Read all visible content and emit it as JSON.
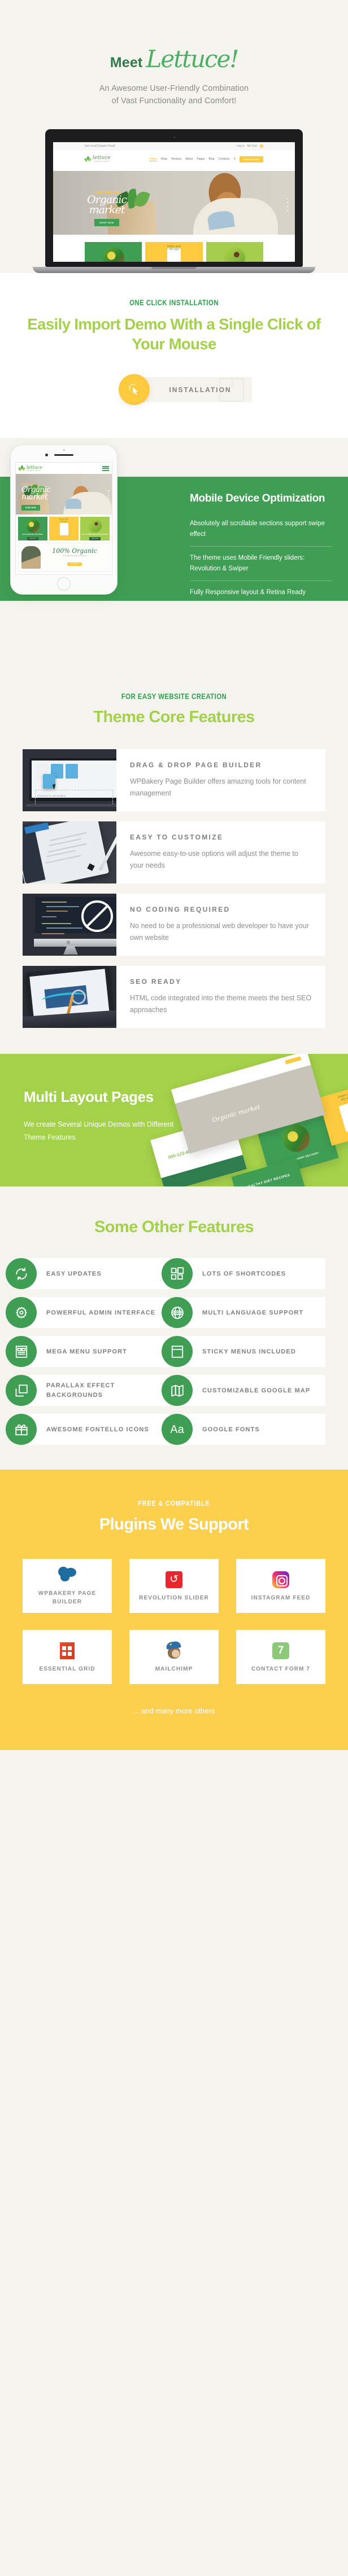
{
  "hero": {
    "title_meet": "Meet",
    "title_brand": "Lettuce!",
    "subtitle_line1": "An Awesome User-Friendly Combination",
    "subtitle_line2": "of Vast Functionality  and Comfort!",
    "accent_green": "#4caf63",
    "bg": "#f4f3ed"
  },
  "laptop_demo": {
    "topbar_left": "Eat Local Organic Food!",
    "topbar_login": "Log in",
    "topbar_cart": "My Cart",
    "cart_count": "0",
    "logo_name": "lettuce",
    "logo_tagline": "Online store",
    "menu": [
      "Home",
      "Shop",
      "Recipes",
      "About",
      "Pages",
      "Blog",
      "Contacts"
    ],
    "search_icon": "search-icon",
    "header_button": "ORDER NOW",
    "slide_kicker": "Your favorite",
    "slide_title_1": "Organic",
    "slide_title_2": "market",
    "slide_button": "SHOP NOW",
    "card_middle_label_1": "Order with",
    "card_middle_label_2": "the app"
  },
  "oneclick": {
    "eyebrow": "ONE CLICK INSTALLATION",
    "title": "Easily Import Demo With a Single Click of Your Mouse",
    "button_label": "INSTALLATION",
    "button_icon": "cursor-click-icon",
    "circle_color": "#fcc93f",
    "title_color": "#a3d14a"
  },
  "mobile": {
    "heading": "Mobile Device Optimization",
    "bullets": [
      "Absolutely all scrollable sections support swipe effect",
      "The theme uses Mobile Friendly sliders: Revolution & Swiper",
      "Fully Responsive layout & Retina Ready"
    ],
    "bg_color": "#3f9e53",
    "phone_demo": {
      "logo_name": "lettuce",
      "logo_tagline": "Online store",
      "menu_icon": "hamburger-menu-icon",
      "slide_kicker": "Your favorite",
      "slide_title_1": "Organic",
      "slide_title_2": "market",
      "slide_button": "SHOP NOW",
      "card1_label": "OUR GROCERY DELIVERY",
      "card1_button": "SHOP NOW",
      "card2_label_1": "Order with",
      "card2_label_2": "the app",
      "card3_label": "GIFT CARDS AND CERTIFICATES",
      "card3_button": "READ MORE",
      "banner_title": "100% Organic",
      "banner_sub": "Your Favorite Products Direct Form Field",
      "banner_button": "READ MORE"
    }
  },
  "core": {
    "eyebrow": "FOR EASY WEBSITE CREATION",
    "title": "Theme Core Features",
    "features": [
      {
        "title": "DRAG & DROP PAGE  BUILDER",
        "desc": "WPBakery Page Builder offers amazing tools for content management",
        "image_name": "drag-drop-builder-screenshot",
        "caption": "Drag here to add widgets"
      },
      {
        "title": "EASY TO CUSTOMIZE",
        "desc": "Awesome easy-to-use options will adjust the theme to your needs",
        "image_name": "tablet-stylus-screenshot"
      },
      {
        "title": "NO CODING REQUIRED",
        "desc": "No need to be a professional web developer to have your own website",
        "image_name": "imac-code-no-sign-screenshot"
      },
      {
        "title": "SEO READY",
        "desc": "HTML code integrated into the theme meets the best SEO approaches",
        "image_name": "tablet-analytics-screenshot"
      }
    ]
  },
  "multi_layout": {
    "heading": "Multi Layout Pages",
    "paragraph": "We create Several Unique Demos with Different Theme Features",
    "bg_color": "#a3d14a",
    "mock_labels": {
      "hero_title": "Organic market",
      "card_grocery": "OUR GROCERY DELIVERY",
      "card_app_1": "Order with",
      "card_app_2": "the app",
      "card_health": "HEALTHY DIET RECIPES",
      "phone": "000-123-456789"
    }
  },
  "other_features": {
    "title": "Some Other Features",
    "items": [
      {
        "label": "EASY UPDATES",
        "icon": "refresh-cycle-icon"
      },
      {
        "label": "LOTS OF SHORTCODES",
        "icon": "grid-blocks-icon"
      },
      {
        "label": "POWERFUL ADMIN INTERFACE",
        "icon": "gear-icon"
      },
      {
        "label": "MULTI LANGUAGE SUPPORT",
        "icon": "globe-icon"
      },
      {
        "label": "MEGA MENU SUPPORT",
        "icon": "mega-menu-icon"
      },
      {
        "label": "STICKY MENUS INCLUDED",
        "icon": "sticky-window-icon"
      },
      {
        "label": "PARALLAX EFFECT BACKGROUNDS",
        "icon": "layers-icon"
      },
      {
        "label": "CUSTOMIZABLE GOOGLE MAP",
        "icon": "map-fold-icon"
      },
      {
        "label": "AWESOME FONTELLO ICONS",
        "icon": "gift-box-icon"
      },
      {
        "label": "GOOGLE FONTS",
        "icon": "typography-aa-icon"
      }
    ],
    "icon_bg": "#3f9e53"
  },
  "plugins": {
    "eyebrow": "FREE & COMPATIBLE",
    "title": "Plugins We Support",
    "bg_color": "#fccf4d",
    "items": [
      {
        "label": "WPBAKERY PAGE BUILDER",
        "icon": "wpbakery-logo"
      },
      {
        "label": "REVOLUTION SLIDER",
        "icon": "revolution-slider-logo"
      },
      {
        "label": "INSTAGRAM FEED",
        "icon": "instagram-logo"
      },
      {
        "label": "ESSENTIAL GRID",
        "icon": "essential-grid-logo"
      },
      {
        "label": "MAILCHIMP",
        "icon": "mailchimp-logo"
      },
      {
        "label": "CONTACT FORM 7",
        "icon": "contact-form-7-logo",
        "badge": "7"
      }
    ],
    "footnote": "... and many more others"
  }
}
